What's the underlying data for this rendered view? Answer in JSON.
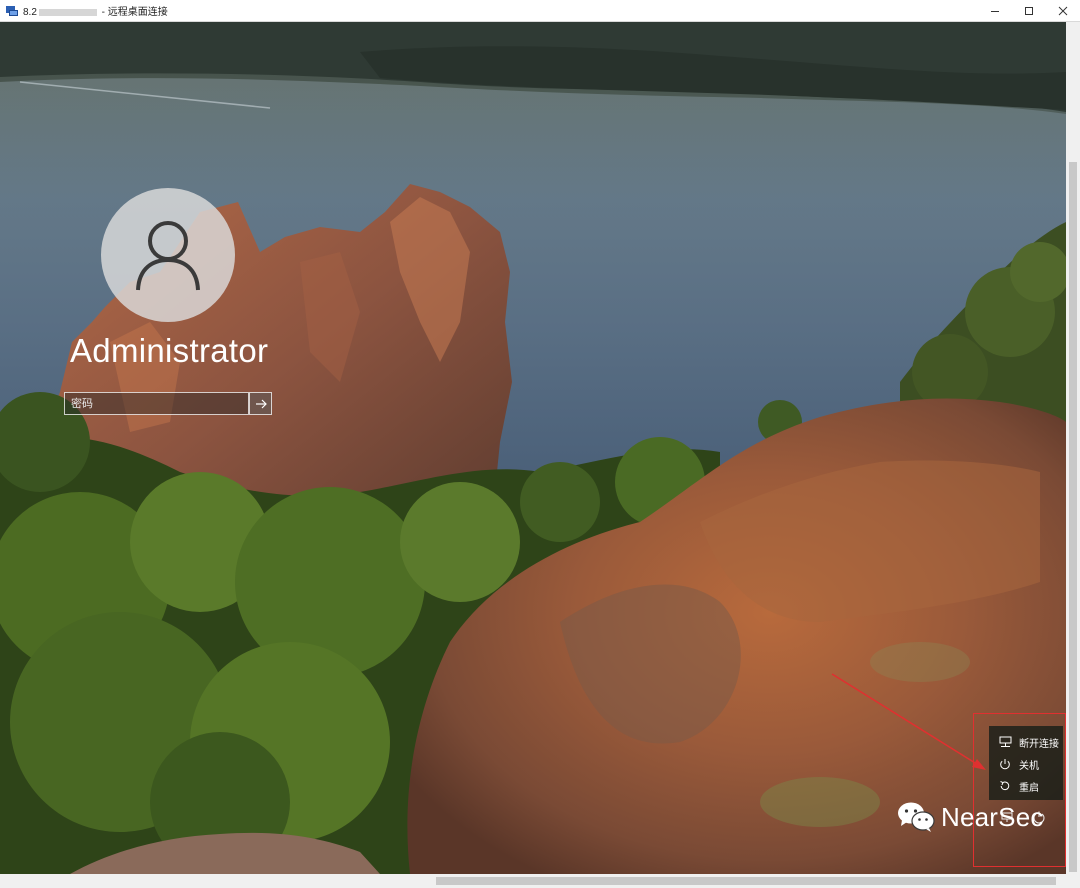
{
  "window": {
    "title_prefix": "8.2",
    "title_suffix": " - 远程桌面连接",
    "buttons": [
      "minimize",
      "maximize",
      "close"
    ]
  },
  "login": {
    "username": "Administrator",
    "password_placeholder": "密码",
    "password_value": ""
  },
  "power_menu": {
    "items": [
      {
        "label": "断开连接",
        "icon": "disconnect-icon"
      },
      {
        "label": "关机",
        "icon": "power-icon"
      },
      {
        "label": "重启",
        "icon": "restart-icon"
      }
    ]
  },
  "watermark": {
    "text": "NearSec"
  },
  "colors": {
    "highlight": "#e03030",
    "menu_bg": "#191e19",
    "text": "#ffffff"
  }
}
